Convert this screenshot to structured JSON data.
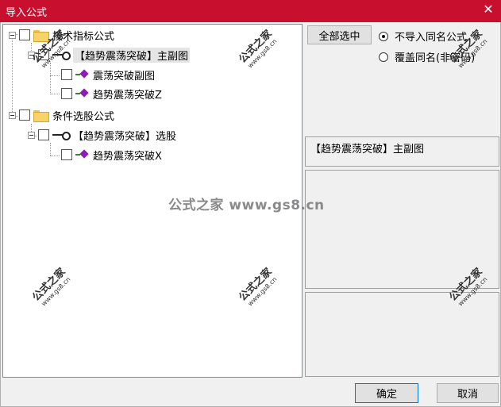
{
  "window": {
    "title": "导入公式",
    "close_glyph": "✕"
  },
  "tree": {
    "nodes": [
      {
        "label": "技术指标公式"
      },
      {
        "label": "【趋势震荡突破】主副图"
      },
      {
        "label": "震荡突破副图"
      },
      {
        "label": "趋势震荡突破Z"
      },
      {
        "label": "条件选股公式"
      },
      {
        "label": "【趋势震荡突破】选股"
      },
      {
        "label": "趋势震荡突破X"
      }
    ]
  },
  "options": {
    "select_all": "全部选中",
    "radio_skip": "不导入同名公式",
    "radio_overwrite": "覆盖同名(非密码)",
    "selected_value": "不导入同名公式"
  },
  "detail": {
    "formula_name": "【趋势震荡突破】主副图"
  },
  "footer": {
    "ok": "确定",
    "cancel": "取消"
  },
  "watermark": {
    "center": "公式之家 www.gs8.cn",
    "brand": "公式之家",
    "url": "www.gs8.cn"
  }
}
